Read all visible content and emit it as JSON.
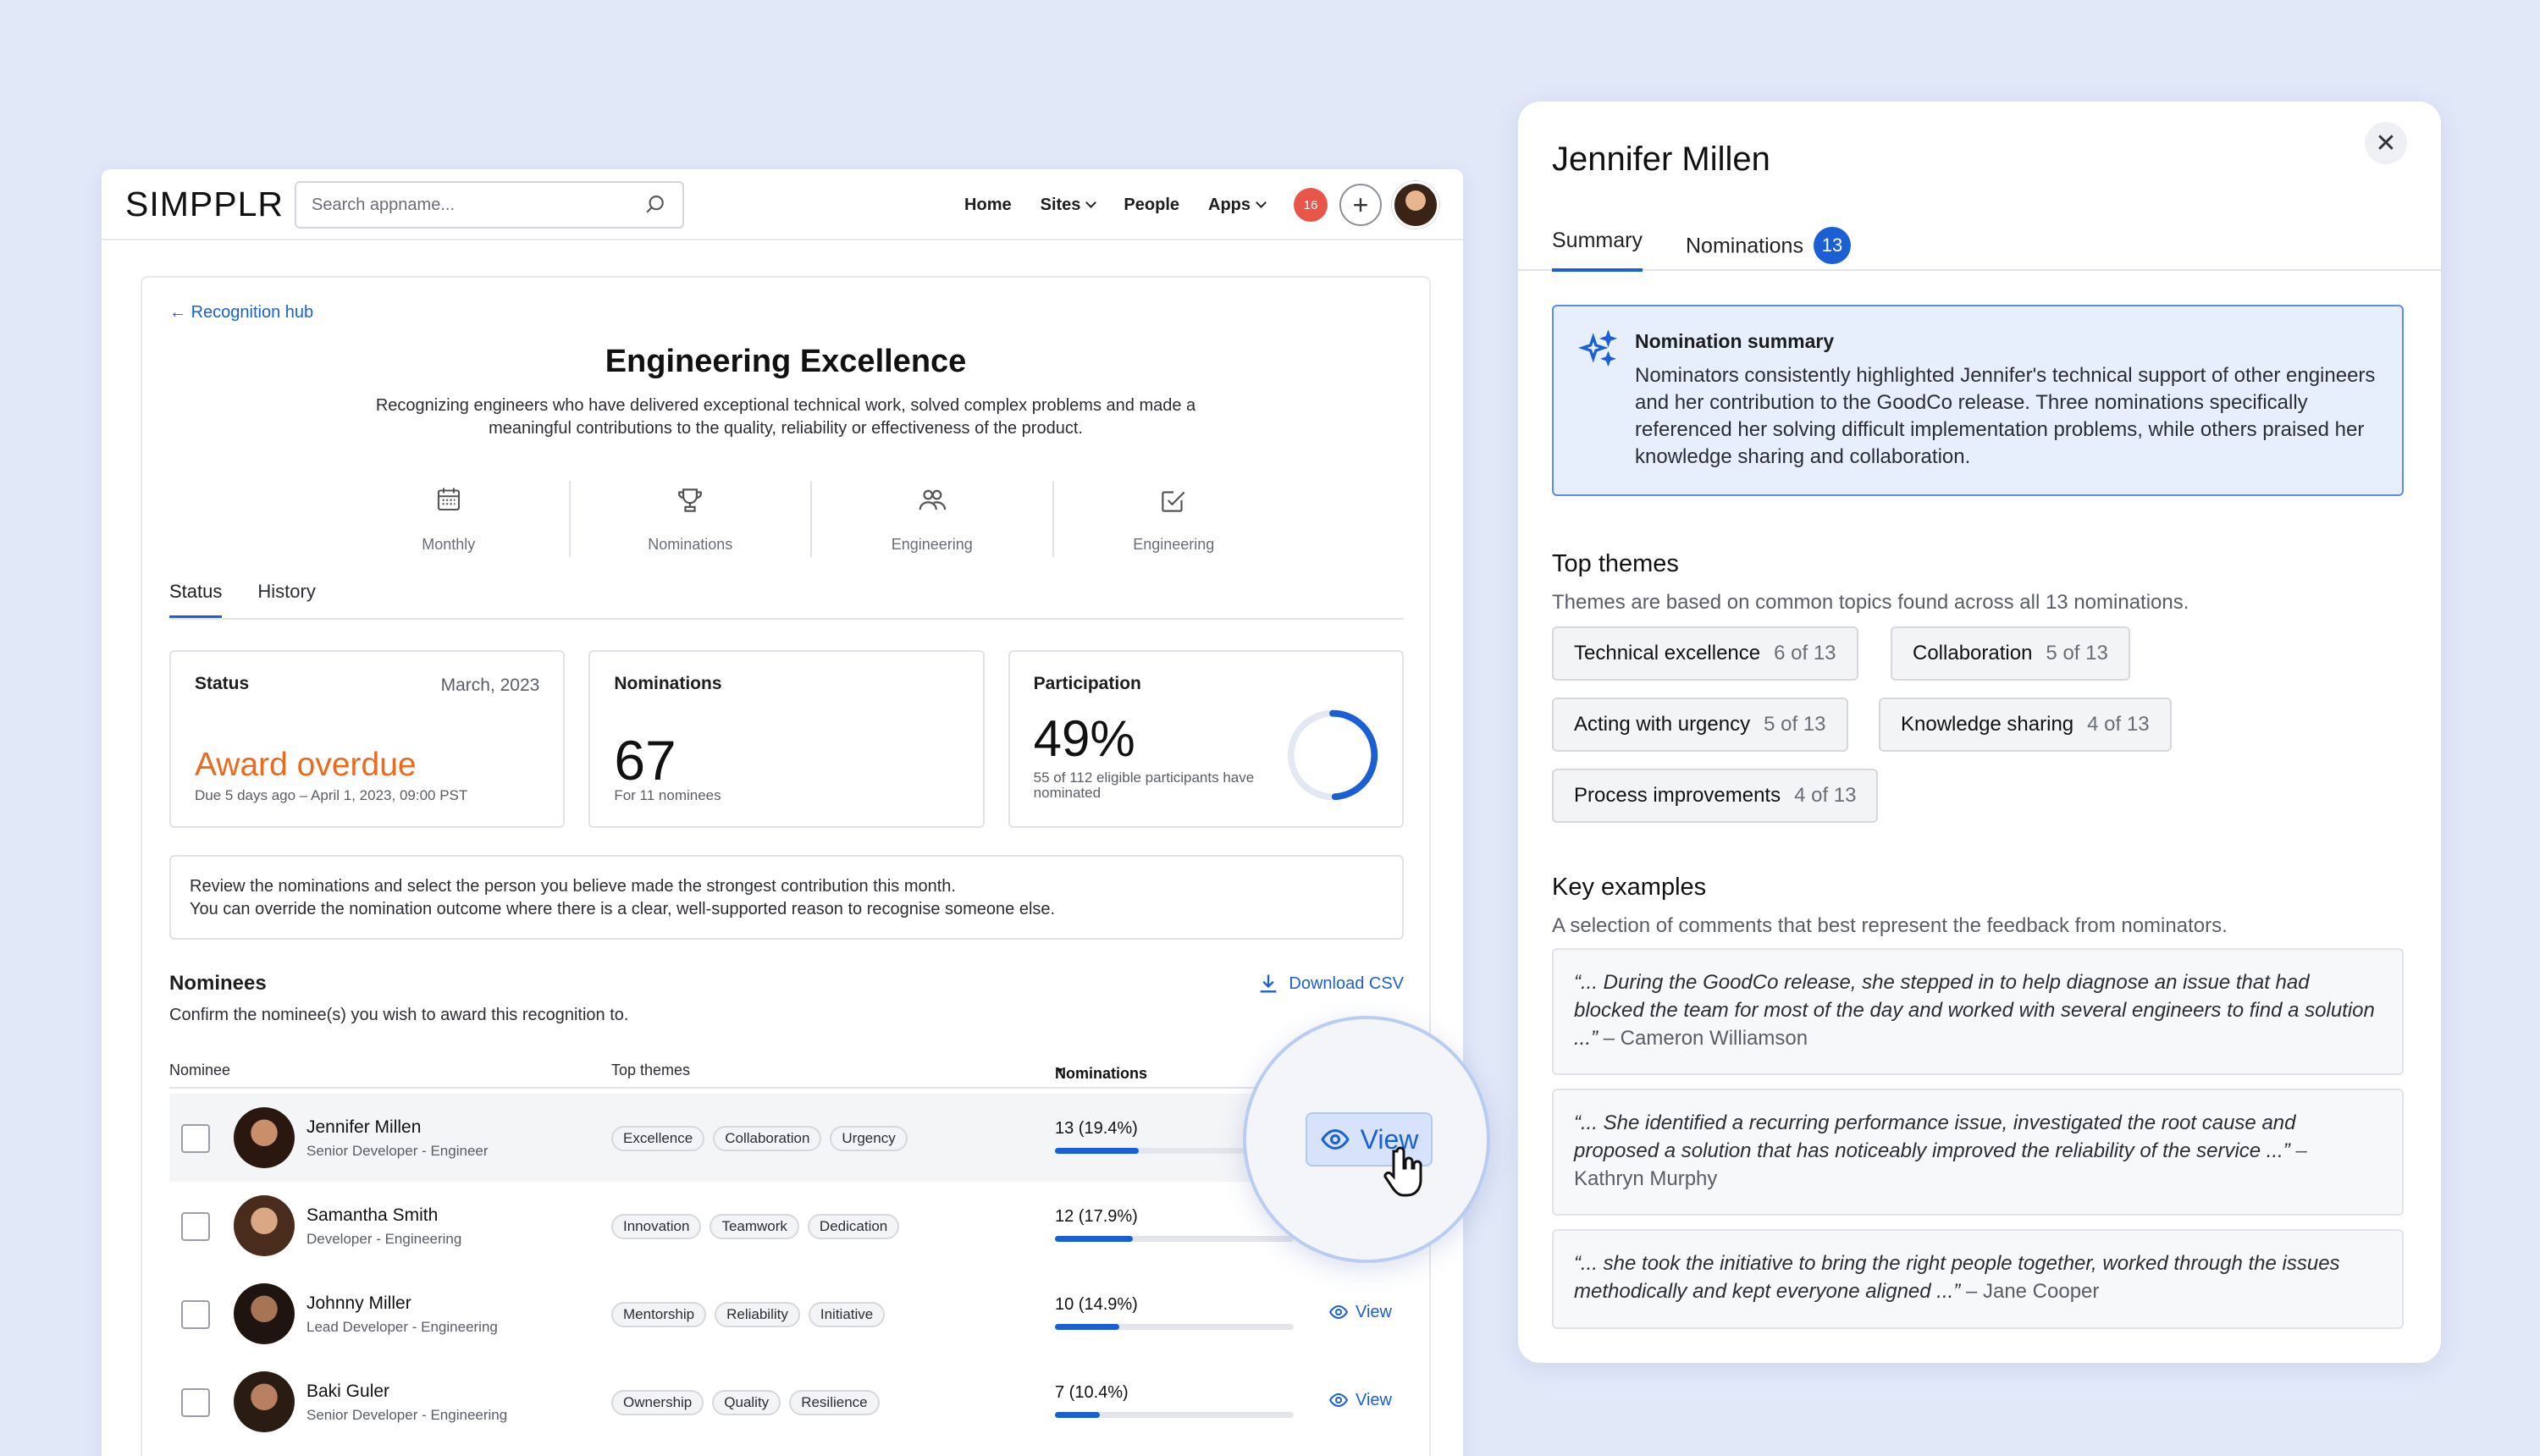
{
  "app": {
    "logo": "SIMPPLR",
    "search_placeholder": "Search appname...",
    "nav": {
      "home": "Home",
      "sites": "Sites",
      "people": "People",
      "apps": "Apps"
    },
    "notifications_count": "16"
  },
  "page": {
    "back_link": "Recognition hub",
    "title": "Engineering Excellence",
    "description": "Recognizing engineers who have delivered exceptional technical work, solved complex problems and made a meaningful contributions to the quality, reliability or effectiveness of the product.",
    "stats": [
      {
        "icon": "calendar-icon",
        "label": "Monthly"
      },
      {
        "icon": "trophy-icon",
        "label": "Nominations"
      },
      {
        "icon": "people-icon",
        "label": "Engineering"
      },
      {
        "icon": "checklist-icon",
        "label": "Engineering"
      }
    ],
    "tabs": [
      "Status",
      "History"
    ],
    "status_card": {
      "label": "Status",
      "date": "March, 2023",
      "value": "Award overdue",
      "due": "Due 5 days ago – April 1, 2023, 09:00 PST"
    },
    "nominations_card": {
      "label": "Nominations",
      "value": "67",
      "sub": "For 11 nominees"
    },
    "participation_card": {
      "label": "Participation",
      "value": "49%",
      "sub": "55 of 112 eligible participants have nominated",
      "fraction": 0.49
    },
    "note_line1": "Review the nominations and select the person you believe made the strongest contribution this month.",
    "note_line2": "You can override the nomination outcome where there is a clear, well-supported reason to recognise someone else.",
    "nominees_title": "Nominees",
    "nominees_sub": "Confirm the nominee(s) you wish to award this recognition to.",
    "download": "Download CSV",
    "columns": {
      "nominee": "Nominee",
      "themes": "Top themes",
      "nominations": "Nominations"
    },
    "rows": [
      {
        "name": "Jennifer Millen",
        "role": "Senior Developer - Engineer",
        "themes": [
          "Excellence",
          "Collaboration",
          "Urgency"
        ],
        "count": "13 (19.4%)",
        "share": 0.194,
        "view": "View"
      },
      {
        "name": "Samantha Smith",
        "role": "Developer - Engineering",
        "themes": [
          "Innovation",
          "Teamwork",
          "Dedication"
        ],
        "count": "12 (17.9%)",
        "share": 0.179,
        "view": "View"
      },
      {
        "name": "Johnny Miller",
        "role": "Lead Developer - Engineering",
        "themes": [
          "Mentorship",
          "Reliability",
          "Initiative"
        ],
        "count": "10 (14.9%)",
        "share": 0.149,
        "view": "View"
      },
      {
        "name": "Baki Guler",
        "role": "Senior Developer - Engineering",
        "themes": [
          "Ownership",
          "Quality",
          "Resilience"
        ],
        "count": "7 (10.4%)",
        "share": 0.104,
        "view": "View"
      }
    ],
    "magnified_view": "View"
  },
  "panel": {
    "title": "Jennifer Millen",
    "tabs": {
      "summary": "Summary",
      "nominations": "Nominations",
      "nominations_count": "13"
    },
    "summary_title": "Nomination summary",
    "summary_body": "Nominators consistently highlighted Jennifer's technical support of other engineers and her contribution to the GoodCo release. Three nominations specifically referenced her solving difficult implementation problems, while others praised her knowledge sharing and collaboration.",
    "themes_title": "Top themes",
    "themes_sub": "Themes are based on common topics found across all 13 nominations.",
    "themes": [
      {
        "name": "Technical excellence",
        "count": "6 of 13"
      },
      {
        "name": "Collaboration",
        "count": "5 of 13"
      },
      {
        "name": "Acting with urgency",
        "count": "5 of 13"
      },
      {
        "name": "Knowledge sharing",
        "count": "4 of 13"
      },
      {
        "name": "Process improvements",
        "count": "4 of 13"
      }
    ],
    "examples_title": "Key examples",
    "examples_sub": "A selection of comments that best represent the feedback from nominators.",
    "examples": [
      {
        "quote": "“... During the GoodCo release, she stepped in to help diagnose an issue that had blocked the team for most of the day and worked with several engineers to find a solution ...”",
        "author": " – Cameron Williamson"
      },
      {
        "quote": "“... She identified a recurring performance issue, investigated the root cause and proposed a solution that has noticeably improved the reliability of the service ...”",
        "author": " – Kathryn Murphy"
      },
      {
        "quote": "“... she took the initiative to bring the right people together, worked through the issues methodically and kept everyone aligned ...”",
        "author": " – Jane Cooper"
      }
    ]
  },
  "colors": {
    "accent": "#1a5fd3",
    "overdue": "#ec6a1c",
    "badge": "#e8564a",
    "background": "#e1e8f8"
  }
}
